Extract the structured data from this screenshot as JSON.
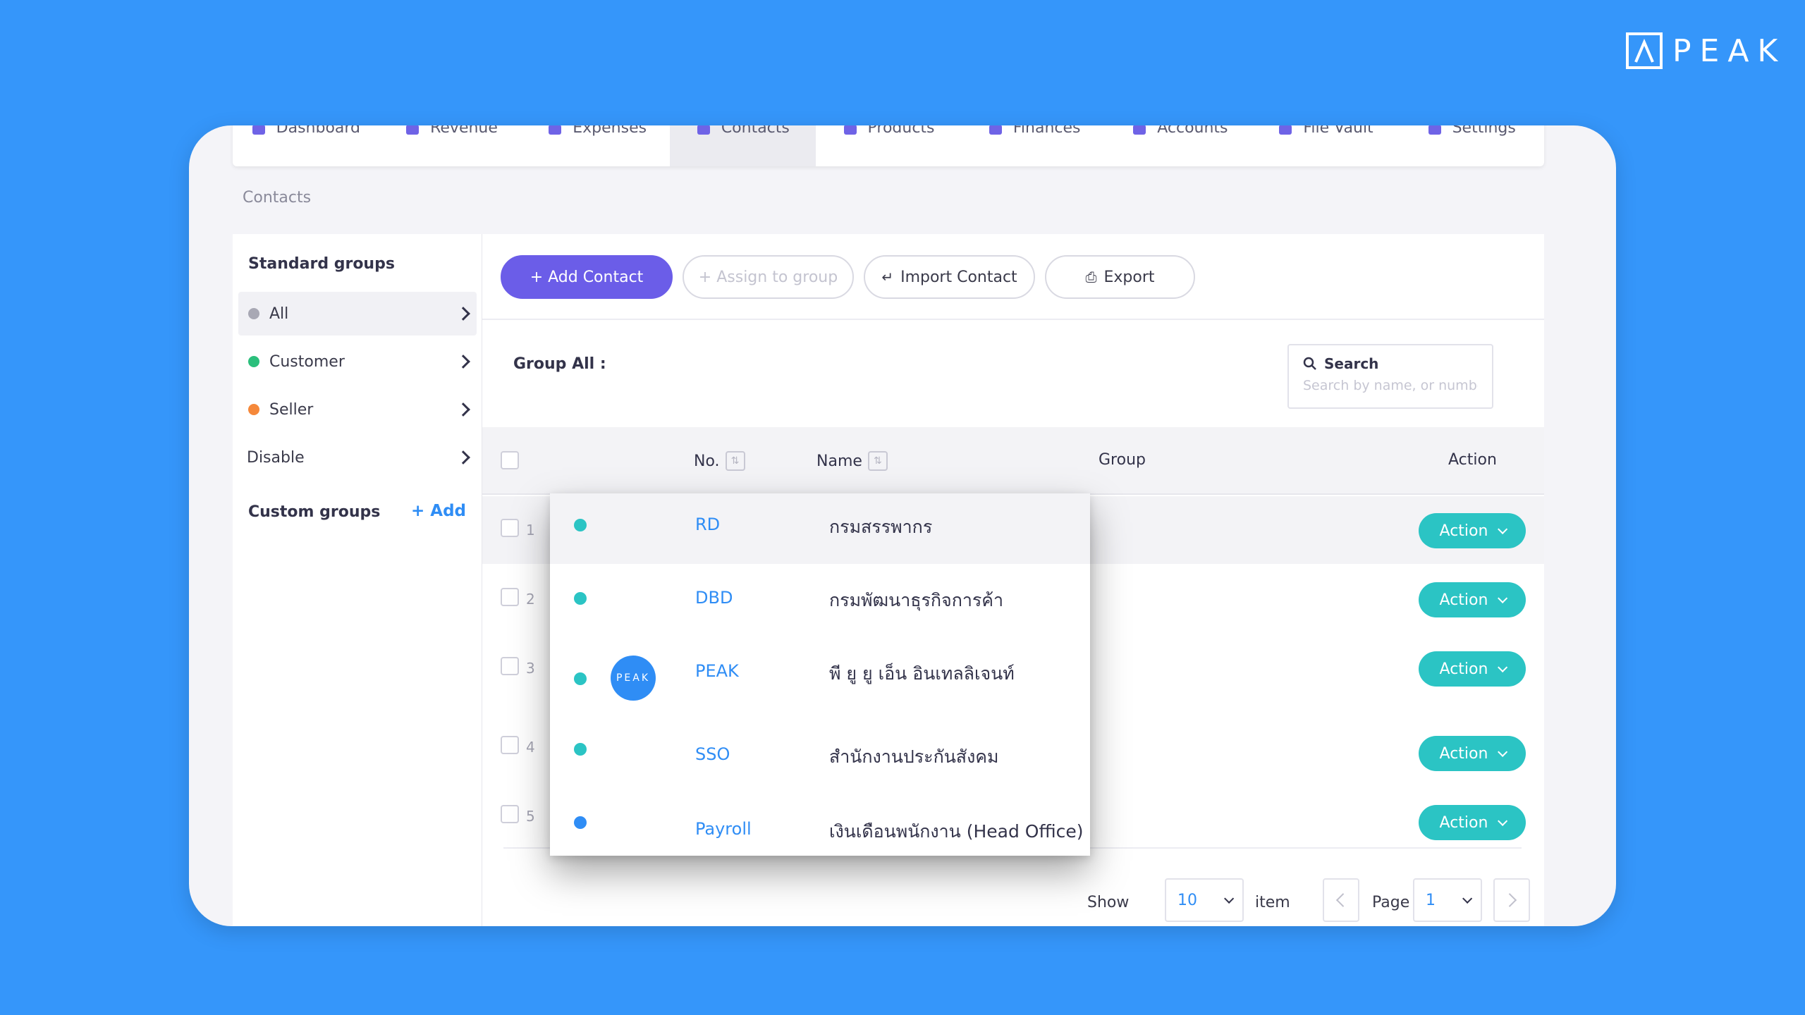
{
  "brand": {
    "name": "PEAK"
  },
  "topnav": {
    "items": [
      {
        "label": "Dashboard",
        "icon": "dashboard-icon"
      },
      {
        "label": "Revenue",
        "icon": "revenue-icon"
      },
      {
        "label": "Expenses",
        "icon": "expenses-icon"
      },
      {
        "label": "Contacts",
        "icon": "contacts-icon",
        "active": true
      },
      {
        "label": "Products",
        "icon": "products-icon"
      },
      {
        "label": "Finances",
        "icon": "finances-icon"
      },
      {
        "label": "Accounts",
        "icon": "accounts-icon"
      },
      {
        "label": "File Vault",
        "icon": "folder-icon"
      },
      {
        "label": "Settings",
        "icon": "gear-icon"
      }
    ]
  },
  "breadcrumb": "Contacts",
  "sidebar": {
    "standard_title": "Standard groups",
    "items": [
      {
        "label": "All",
        "color": "#a8a8b4"
      },
      {
        "label": "Customer",
        "color": "#2bbf7c"
      },
      {
        "label": "Seller",
        "color": "#f5883a"
      },
      {
        "label": "Disable",
        "color": ""
      }
    ],
    "custom_title": "Custom groups",
    "add_label": "+ Add"
  },
  "toolbar": {
    "add_contact": "+ Add Contact",
    "assign_group": "+ Assign to group",
    "import_contact": "Import Contact",
    "export": "Export"
  },
  "group_title": "Group All :",
  "search": {
    "label": "Search",
    "placeholder": "Search by name, or numbe"
  },
  "table": {
    "columns": {
      "no": "No.",
      "name": "Name",
      "group": "Group",
      "action": "Action"
    },
    "rows": [
      {
        "num": "1",
        "action": "Action"
      },
      {
        "num": "2",
        "action": "Action"
      },
      {
        "num": "3",
        "action": "Action"
      },
      {
        "num": "4",
        "action": "Action"
      },
      {
        "num": "5",
        "action": "Action"
      }
    ]
  },
  "popup": {
    "rows": [
      {
        "code": "RD",
        "name": "กรมสรรพากร",
        "dot": "#2bc4c4"
      },
      {
        "code": "DBD",
        "name": "กรมพัฒนาธุรกิจการค้า",
        "dot": "#2bc4c4"
      },
      {
        "code": "PEAK",
        "name": "พี ยู ยู เอ็น อินเทลลิเจนท์",
        "dot": "#2bc4c4",
        "avatar": "PEAK"
      },
      {
        "code": "SSO",
        "name": "สำนักงานประกันสังคม",
        "dot": "#2bc4c4"
      },
      {
        "code": "Payroll",
        "name": "เงินเดือนพนักงาน (Head Office)",
        "dot": "#2f8df5"
      }
    ]
  },
  "pagination": {
    "show_label": "Show",
    "per_page": "10",
    "item_label": "item",
    "page_label": "Page",
    "page": "1"
  }
}
